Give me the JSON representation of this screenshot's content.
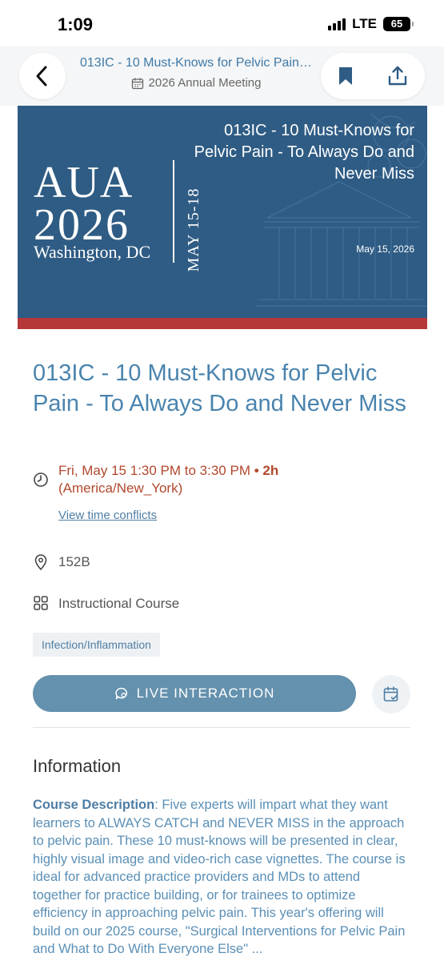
{
  "status_bar": {
    "time": "1:09",
    "network": "LTE",
    "battery": "65"
  },
  "nav": {
    "title": "013IC - 10 Must-Knows for Pelvic Pain - To Always Do and Never Miss",
    "subtitle": "2026 Annual Meeting",
    "back_icon": "chevron-left-icon",
    "bookmark_icon": "bookmark-icon",
    "share_icon": "share-icon"
  },
  "banner": {
    "word": "AUA",
    "year": "2026",
    "city": "Washington, DC",
    "dates": "MAY 15-18",
    "title": "013IC - 10 Must-Knows for Pelvic Pain - To Always Do and Never Miss",
    "date": "May 15, 2026",
    "colors": {
      "background": "#2f5c84",
      "stripe": "#b5373a"
    }
  },
  "session": {
    "title": "013IC - 10 Must-Knows for Pelvic Pain - To Always Do and Never Miss",
    "time_main": "Fri, May 15 1:30  PM to 3:30  PM",
    "duration_sep": " • ",
    "duration": "2h",
    "timezone": "(America/New_York)",
    "conflicts_link": "View time conflicts",
    "location": "152B",
    "type": "Instructional Course",
    "tag": "Infection/Inflammation",
    "live_button": "LIVE INTERACTION"
  },
  "info": {
    "heading": "Information",
    "desc_label": "Course Description",
    "desc_text": ": Five experts will impart what they want learners to ALWAYS CATCH and NEVER MISS in the approach to pelvic pain. These 10 must-knows will be presented in clear, highly visual image and video-rich case vignettes. The course is ideal for advanced practice providers and MDs to attend together for practice building, or for trainees to optimize efficiency in approaching pelvic pain. This year's offering will build on our 2025 course, \"Surgical Interventions for Pelvic Pain and What to Do With Everyone Else\" ..."
  }
}
